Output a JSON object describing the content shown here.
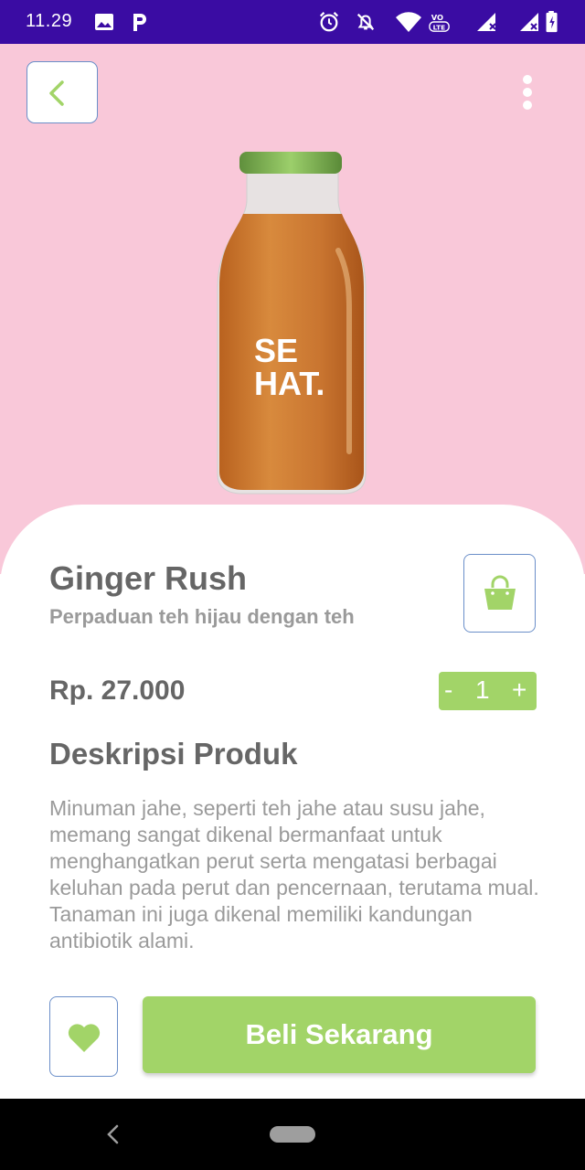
{
  "status_bar": {
    "time": "11.29",
    "icons": [
      "image-icon",
      "parking-app-icon",
      "alarm-icon",
      "silent-icon",
      "wifi-icon",
      "volte-icon",
      "signal-icon",
      "signal-icon",
      "battery-icon"
    ],
    "background": "#3a0ca3"
  },
  "hero": {
    "background": "#f9c8d9",
    "bottle_label_line1": "SE",
    "bottle_label_line2": "HAT."
  },
  "product": {
    "name": "Ginger Rush",
    "subtitle": "Perpaduan teh hijau dengan teh",
    "price": "Rp. 27.000",
    "quantity": "1",
    "minus_label": "-",
    "plus_label": "+",
    "description_title": "Deskripsi Produk",
    "description": "Minuman jahe, seperti teh jahe atau susu jahe, memang sangat dikenal bermanfaat untuk menghangatkan perut serta mengatasi berbagai keluhan pada perut dan pencernaan, terutama mual. Tanaman ini juga dikenal memiliki kandungan antibiotik alami."
  },
  "actions": {
    "buy_label": "Beli Sekarang"
  },
  "colors": {
    "accent_green": "#a2d468",
    "border_blue": "#6b8fc9",
    "text_dark": "#666666",
    "text_light": "#9a9a9a"
  }
}
